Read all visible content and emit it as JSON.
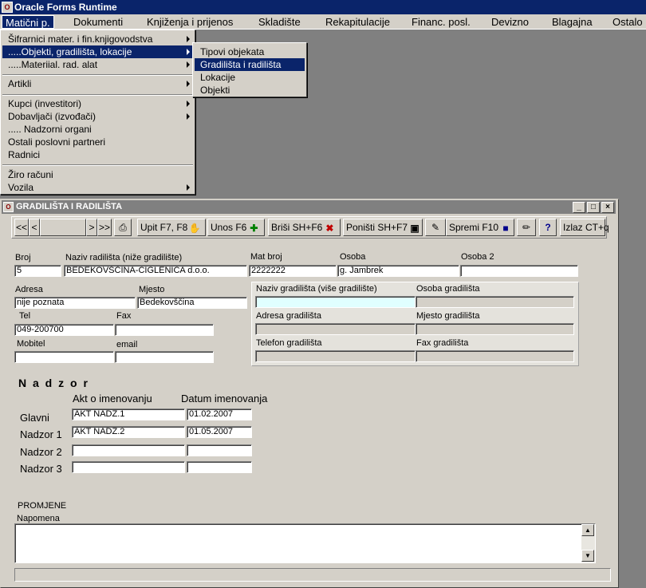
{
  "app": {
    "title": "Oracle Forms Runtime"
  },
  "menubar": [
    "Matični p.",
    "Dokumenti",
    "Knjiženja i prijenos",
    "Skladište",
    "Rekapitulacije",
    "Financ. posl.",
    "Devizno",
    "Blagajna",
    "Ostalo"
  ],
  "menu_maticni": {
    "items": [
      "Šifrarnici mater. i fin.knjigovodstva",
      ".....Objekti, gradilišta, lokacije",
      ".....Materiial. rad. alat",
      "Artikli",
      "Kupci (investitori)",
      "Dobavljači (izvođači)",
      "..... Nadzorni organi",
      "Ostali poslovni partneri",
      "Radnici",
      "Žiro računi",
      "Vozila"
    ]
  },
  "submenu_objekti": {
    "items": [
      "Tipovi objekata",
      "Gradilišta i radilišta",
      "Lokacije",
      "Objekti"
    ]
  },
  "window": {
    "title": "GRADILIŠTA I RADILIŠTA"
  },
  "toolbar": {
    "nav": [
      "<<",
      "<",
      ">",
      ">>"
    ],
    "upit": "Upit F7, F8",
    "unos": "Unos F6",
    "brisi": "Briši  SH+F6",
    "ponisti": "Poništi SH+F7",
    "spremi": "Spremi F10",
    "help": "?",
    "izlaz": "Izlaz CT+q"
  },
  "form": {
    "broj_label": "Broj",
    "broj": "5",
    "naziv_label": "Naziv radilišta (niže gradilište)",
    "naziv": "BEDEKOVŠČINA-CIGLENICA d.o.o.",
    "mat_broj_label": "Mat broj",
    "mat_broj": "2222222",
    "osoba_label": "Osoba",
    "osoba": "g. Jambrek",
    "osoba2_label": "Osoba 2",
    "osoba2": "",
    "adresa_label": "Adresa",
    "adresa": "nije poznata",
    "mjesto_label": "Mjesto",
    "mjesto": "Bedekovščina",
    "tel_label": "Tel",
    "tel": "049-200700",
    "fax_label": "Fax",
    "fax": "",
    "mobitel_label": "Mobitel",
    "mobitel": "",
    "email_label": "email",
    "email": "",
    "naziv_grad_label": "Naziv gradilišta (više gradilište)",
    "osoba_grad_label": "Osoba gradilišta",
    "adresa_grad_label": "Adresa gradilišta",
    "mjesto_grad_label": "Mjesto gradilišta",
    "telefon_grad_label": "Telefon gradilišta",
    "fax_grad_label": "Fax gradilišta"
  },
  "nadzor": {
    "title": "N a d z o r",
    "col_akt": "Akt o imenovanju",
    "col_datum": "Datum imenovanja",
    "rows": [
      {
        "label": "Glavni",
        "akt": "AKT NADZ.1",
        "datum": "01.02.2007"
      },
      {
        "label": "Nadzor 1",
        "akt": "AKT NADZ.2",
        "datum": "01.05.2007"
      },
      {
        "label": "Nadzor 2",
        "akt": "",
        "datum": ""
      },
      {
        "label": "Nadzor 3",
        "akt": "",
        "datum": ""
      }
    ]
  },
  "promjene": {
    "title": "PROMJENE",
    "napomena_label": "Napomena",
    "napomena": ""
  }
}
